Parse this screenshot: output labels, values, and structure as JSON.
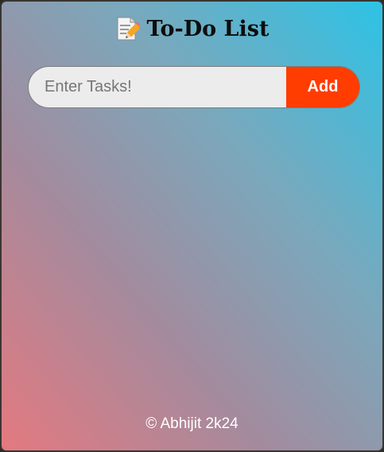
{
  "app": {
    "title_icon": "memo-pencil-icon",
    "title": "To-Do List"
  },
  "task_input": {
    "placeholder": "Enter Tasks!",
    "value": ""
  },
  "add_button": {
    "label": "Add"
  },
  "footer": {
    "text": "© Abhijit 2k24"
  },
  "colors": {
    "add_button": "#ff3d00",
    "gradient_bottom_left": "#e4797f",
    "gradient_top_right": "#2dc3e6",
    "input_background": "#ececec"
  }
}
